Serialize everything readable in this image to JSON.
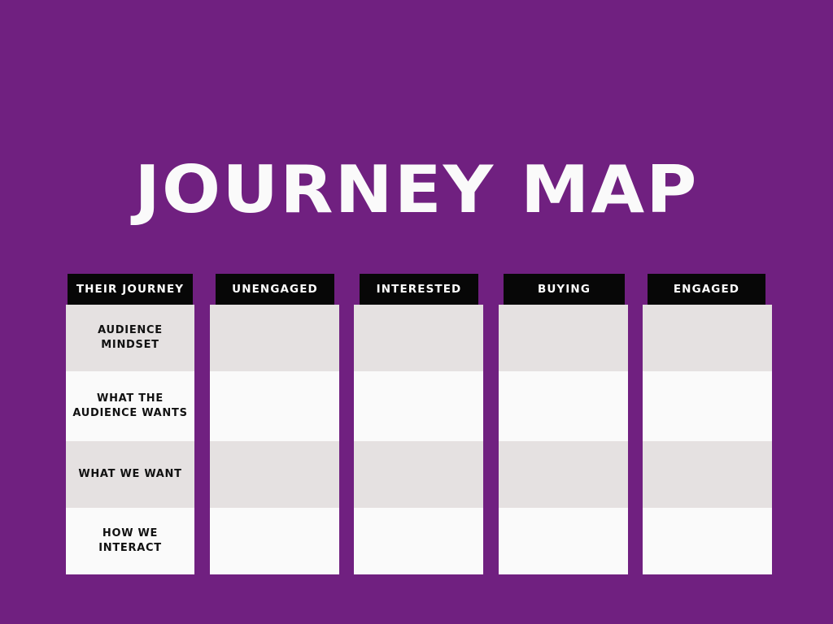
{
  "page": {
    "title": "JOURNEY MAP",
    "background_color": "#702080",
    "header_bar_color": "#070707",
    "header_text_color": "#FFFFFF",
    "row_shade_color": "#E5E1E1",
    "row_plain_color": "#FAFAFA",
    "body_text_color": "#111111"
  },
  "board": {
    "columns": [
      {
        "id": "their-journey",
        "header": "THEIR JOURNEY",
        "is_label_column": true,
        "cells": [
          "AUDIENCE MINDSET",
          "WHAT THE AUDIENCE WANTS",
          "WHAT WE WANT",
          "HOW WE INTERACT"
        ]
      },
      {
        "id": "unengaged",
        "header": "UNENGAGED",
        "is_label_column": false,
        "cells": [
          "",
          "",
          "",
          ""
        ]
      },
      {
        "id": "interested",
        "header": "INTERESTED",
        "is_label_column": false,
        "cells": [
          "",
          "",
          "",
          ""
        ]
      },
      {
        "id": "buying",
        "header": "BUYING",
        "is_label_column": false,
        "cells": [
          "",
          "",
          "",
          ""
        ]
      },
      {
        "id": "engaged",
        "header": "ENGAGED",
        "is_label_column": false,
        "cells": [
          "",
          "",
          "",
          ""
        ]
      }
    ],
    "row_labels": [
      "AUDIENCE MINDSET",
      "WHAT THE AUDIENCE WANTS",
      "WHAT WE WANT",
      "HOW WE INTERACT"
    ]
  }
}
